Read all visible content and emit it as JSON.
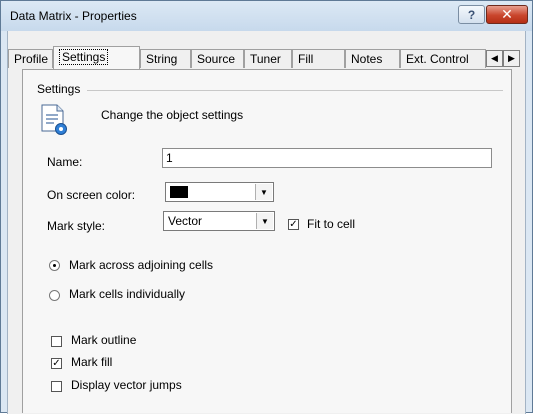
{
  "window": {
    "title": "Data Matrix - Properties",
    "help_glyph": "?",
    "close_glyph": "✕"
  },
  "tabs": [
    {
      "label": "Profile"
    },
    {
      "label": "Settings"
    },
    {
      "label": "String"
    },
    {
      "label": "Source"
    },
    {
      "label": "Tuner"
    },
    {
      "label": "Fill"
    },
    {
      "label": "Notes"
    },
    {
      "label": "Ext. Control"
    }
  ],
  "tab_scroll": {
    "left": "◀",
    "right": "▶"
  },
  "settings": {
    "group_label": "Settings",
    "description": "Change the object settings",
    "name_label": "Name:",
    "name_value": "1",
    "color_label": "On screen color:",
    "color_value": "#000000",
    "mark_style_label": "Mark style:",
    "mark_style_value": "Vector",
    "fit_to_cell_label": "Fit to cell",
    "fit_to_cell_checked": true,
    "radio_across_label": "Mark across adjoining cells",
    "radio_across_selected": true,
    "radio_individual_label": "Mark cells individually",
    "radio_individual_selected": false,
    "mark_outline_label": "Mark outline",
    "mark_outline_checked": false,
    "mark_fill_label": "Mark fill",
    "mark_fill_checked": true,
    "vector_jumps_label": "Display vector jumps",
    "vector_jumps_checked": false
  },
  "check_glyph": "✓",
  "combo_arrow": "▼"
}
